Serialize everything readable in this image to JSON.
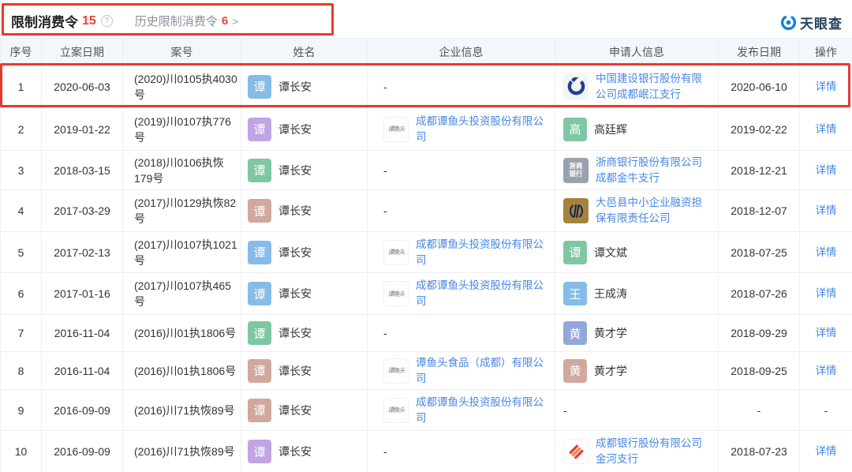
{
  "header": {
    "title": "限制消费令",
    "count": "15",
    "history_label": "历史限制消费令",
    "history_count": "6",
    "chevron": ">",
    "help": "?",
    "brand": "天眼查"
  },
  "logos": {
    "tyt_text": "谭鱼头",
    "zs_line1": "浙商",
    "zs_line2": "银行"
  },
  "colors": {
    "accent_red": "#E9392C",
    "count_red": "#F3413B",
    "link_blue": "#4787E6",
    "brand_blue": "#0A80E6"
  },
  "table": {
    "headers": [
      "序号",
      "立案日期",
      "案号",
      "姓名",
      "企业信息",
      "申请人信息",
      "发布日期",
      "操作"
    ],
    "rows": [
      {
        "no": "1",
        "filed": "2020-06-03",
        "case": "(2020)川0105执4030号",
        "person": {
          "initial": "谭",
          "color": "#85BCE8",
          "name": "谭长安"
        },
        "company": {
          "text": "-"
        },
        "applicant": {
          "kind": "company",
          "logo": "ccb",
          "name": "中国建设银行股份有限公司成都岷江支行"
        },
        "published": "2020-06-10",
        "action": "详情",
        "highlighted": true
      },
      {
        "no": "2",
        "filed": "2019-01-22",
        "case": "(2019)川0107执776号",
        "person": {
          "initial": "谭",
          "color": "#C0A4E4",
          "name": "谭长安"
        },
        "company": {
          "logo": "tyt",
          "name": "成都谭鱼头投资股份有限公司"
        },
        "applicant": {
          "kind": "person",
          "initial": "高",
          "color": "#7FC7A3",
          "name": "高廷辉"
        },
        "published": "2019-02-22",
        "action": "详情"
      },
      {
        "no": "3",
        "filed": "2018-03-15",
        "case": "(2018)川0106执恢179号",
        "person": {
          "initial": "谭",
          "color": "#7FC7A3",
          "name": "谭长安"
        },
        "company": {
          "text": "-"
        },
        "applicant": {
          "kind": "company",
          "logo": "zs",
          "name": "浙商银行股份有限公司成都金牛支行"
        },
        "published": "2018-12-21",
        "action": "详情"
      },
      {
        "no": "4",
        "filed": "2017-03-29",
        "case": "(2017)川0129执恢82号",
        "person": {
          "initial": "谭",
          "color": "#D1A99C",
          "name": "谭长安"
        },
        "company": {
          "text": "-"
        },
        "applicant": {
          "kind": "company",
          "logo": "dayi",
          "name": "大邑县中小企业融资担保有限责任公司"
        },
        "published": "2018-12-07",
        "action": "详情"
      },
      {
        "no": "5",
        "filed": "2017-02-13",
        "case": "(2017)川0107执1021号",
        "person": {
          "initial": "谭",
          "color": "#85BCE8",
          "name": "谭长安"
        },
        "company": {
          "logo": "tyt",
          "name": "成都谭鱼头投资股份有限公司"
        },
        "applicant": {
          "kind": "person",
          "initial": "谭",
          "color": "#7FC7A3",
          "name": "谭文斌"
        },
        "published": "2018-07-25",
        "action": "详情"
      },
      {
        "no": "6",
        "filed": "2017-01-16",
        "case": "(2017)川0107执465号",
        "person": {
          "initial": "谭",
          "color": "#85BCE8",
          "name": "谭长安"
        },
        "company": {
          "logo": "tyt",
          "name": "成都谭鱼头投资股份有限公司"
        },
        "applicant": {
          "kind": "person",
          "initial": "王",
          "color": "#85BCE8",
          "name": "王成涛"
        },
        "published": "2018-07-26",
        "action": "详情"
      },
      {
        "no": "7",
        "filed": "2016-11-04",
        "case": "(2016)川01执1806号",
        "person": {
          "initial": "谭",
          "color": "#7FC7A3",
          "name": "谭长安"
        },
        "company": {
          "text": "-"
        },
        "applicant": {
          "kind": "person",
          "initial": "黄",
          "color": "#92A8D8",
          "name": "黄才学"
        },
        "published": "2018-09-29",
        "action": "详情"
      },
      {
        "no": "8",
        "filed": "2016-11-04",
        "case": "(2016)川01执1806号",
        "person": {
          "initial": "谭",
          "color": "#D1A99C",
          "name": "谭长安"
        },
        "company": {
          "logo": "tyt",
          "name": "谭鱼头食品（成都）有限公司"
        },
        "applicant": {
          "kind": "person",
          "initial": "黄",
          "color": "#D1A99C",
          "name": "黄才学"
        },
        "published": "2018-09-25",
        "action": "详情"
      },
      {
        "no": "9",
        "filed": "2016-09-09",
        "case": "(2016)川71执恢89号",
        "person": {
          "initial": "谭",
          "color": "#D1A99C",
          "name": "谭长安"
        },
        "company": {
          "logo": "tyt",
          "name": "成都谭鱼头投资股份有限公司"
        },
        "applicant": {
          "kind": "dash",
          "text": "-"
        },
        "published": "-",
        "action": "-"
      },
      {
        "no": "10",
        "filed": "2016-09-09",
        "case": "(2016)川71执恢89号",
        "person": {
          "initial": "谭",
          "color": "#C0A4E4",
          "name": "谭长安"
        },
        "company": {
          "text": "-"
        },
        "applicant": {
          "kind": "company",
          "logo": "cdb",
          "name": "成都银行股份有限公司金河支行"
        },
        "published": "2018-07-23",
        "action": "详情"
      }
    ]
  }
}
